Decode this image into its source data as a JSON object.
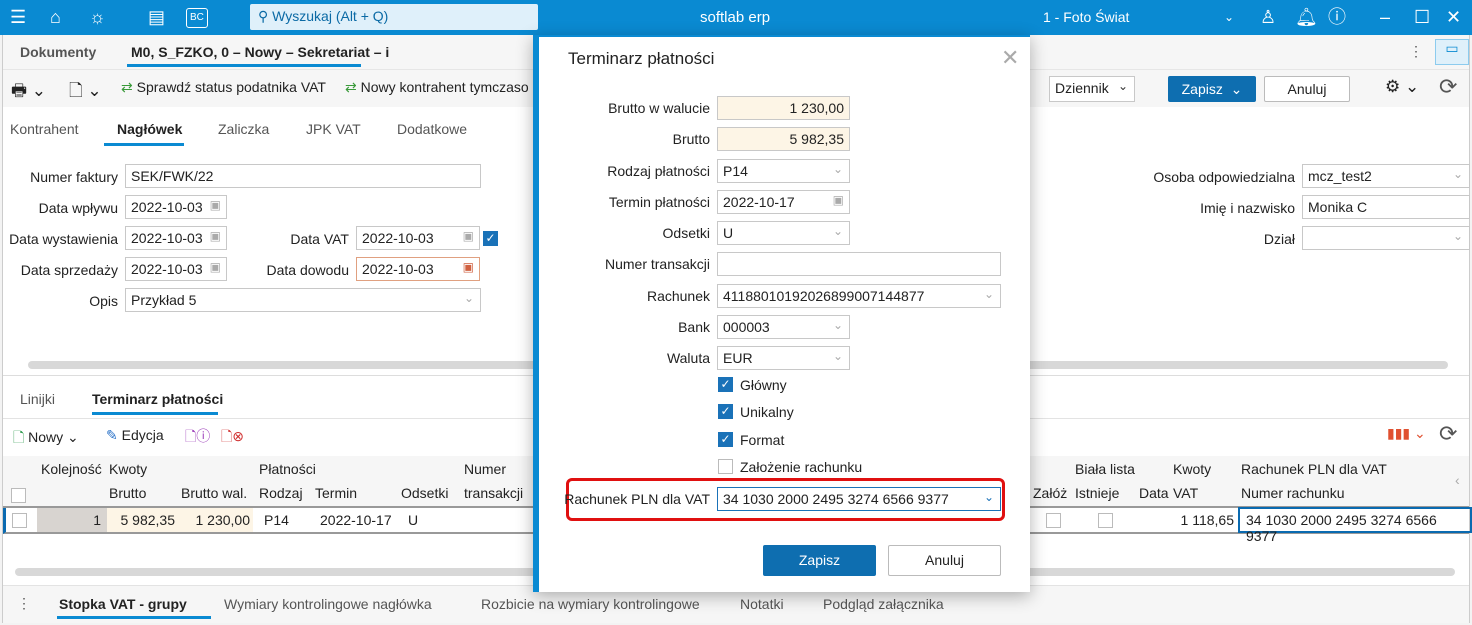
{
  "titlebar": {
    "search_placeholder": "Wyszukaj (Alt + Q)",
    "app_title": "softlab erp",
    "company": "1 - Foto Świat",
    "bc_label": "BC"
  },
  "doc_tabs": {
    "tab1": "Dokumenty",
    "tab2": "M0, S_FZKO, 0 – Nowy – Sekretariat – i"
  },
  "toolbar": {
    "check_vat": "Sprawdź status podatnika VAT",
    "new_contractor": "Nowy kontrahent tymczaso",
    "journal": "Dziennik",
    "save": "Zapisz",
    "cancel": "Anuluj"
  },
  "section_tabs": [
    "Kontrahent",
    "Nagłówek",
    "Zaliczka",
    "JPK VAT",
    "Dodatkowe"
  ],
  "form": {
    "numer_faktury": {
      "label": "Numer faktury",
      "value": "SEK/FWK/22"
    },
    "data_wplywu": {
      "label": "Data wpływu",
      "value": "2022-10-03"
    },
    "data_wystawienia": {
      "label": "Data wystawienia",
      "value": "2022-10-03"
    },
    "data_vat": {
      "label": "Data VAT",
      "value": "2022-10-03"
    },
    "data_sprzedazy": {
      "label": "Data sprzedaży",
      "value": "2022-10-03"
    },
    "data_dowodu": {
      "label": "Data dowodu",
      "value": "2022-10-03"
    },
    "opis": {
      "label": "Opis",
      "value": "Przykład 5"
    },
    "osoba": {
      "label": "Osoba odpowiedzialna",
      "value": "mcz_test2"
    },
    "imie": {
      "label": "Imię i nazwisko",
      "value": "Monika C"
    },
    "dzial": {
      "label": "Dział",
      "value": ""
    }
  },
  "lower_tabs": [
    "Linijki",
    "Terminarz płatności"
  ],
  "grid_toolbar": {
    "new": "Nowy",
    "edit": "Edycja"
  },
  "grid": {
    "groups": {
      "kolejnosc": "Kolejność",
      "kwoty": "Kwoty",
      "platnosci": "Płatności",
      "numer": "Numer",
      "biala_lista": "Biała lista",
      "kwoty2": "Kwoty",
      "rachunek": "Rachunek PLN dla VAT"
    },
    "columns": {
      "brutto": "Brutto",
      "brutto_wal": "Brutto wal.",
      "rodzaj": "Rodzaj",
      "termin": "Termin",
      "odsetki": "Odsetki",
      "transakcji": "transakcji",
      "zaloz": "Załóż",
      "istnieje": "Istnieje",
      "data": "Data",
      "vat": "VAT",
      "numer_rachunku": "Numer rachunku"
    },
    "rows": [
      {
        "kolejnosc": "1",
        "brutto": "5 982,35",
        "brutto_wal": "1 230,00",
        "rodzaj": "P14",
        "termin": "2022-10-17",
        "odsetki": "U",
        "vat": "1 118,65",
        "rachunek": "34 1030 2000 2495 3274 6566 9377"
      }
    ]
  },
  "footer_tabs": [
    "Stopka VAT - grupy",
    "Wymiary kontrolingowe nagłówka",
    "Rozbicie na wymiary kontrolingowe",
    "Notatki",
    "Podgląd załącznika"
  ],
  "dialog": {
    "title": "Terminarz płatności",
    "fields": [
      {
        "label": "Brutto w walucie",
        "value": "1 230,00"
      },
      {
        "label": "Brutto",
        "value": "5 982,35"
      },
      {
        "label": "Rodzaj płatności",
        "value": "P14"
      },
      {
        "label": "Termin płatności",
        "value": "2022-10-17"
      },
      {
        "label": "Odsetki",
        "value": "U"
      },
      {
        "label": "Numer transakcji",
        "value": ""
      },
      {
        "label": "Rachunek",
        "value": "41188010192026899007144877"
      },
      {
        "label": "Bank",
        "value": "000003"
      },
      {
        "label": "Waluta",
        "value": "EUR"
      }
    ],
    "checkboxes": [
      {
        "label": "Główny",
        "checked": true
      },
      {
        "label": "Unikalny",
        "checked": true
      },
      {
        "label": "Format",
        "checked": true
      },
      {
        "label": "Założenie rachunku",
        "checked": false
      }
    ],
    "vat_account": {
      "label": "Rachunek PLN dla VAT",
      "value": "34 1030 2000 2495 3274 6566 9377"
    },
    "save": "Zapisz",
    "cancel": "Anuluj"
  }
}
